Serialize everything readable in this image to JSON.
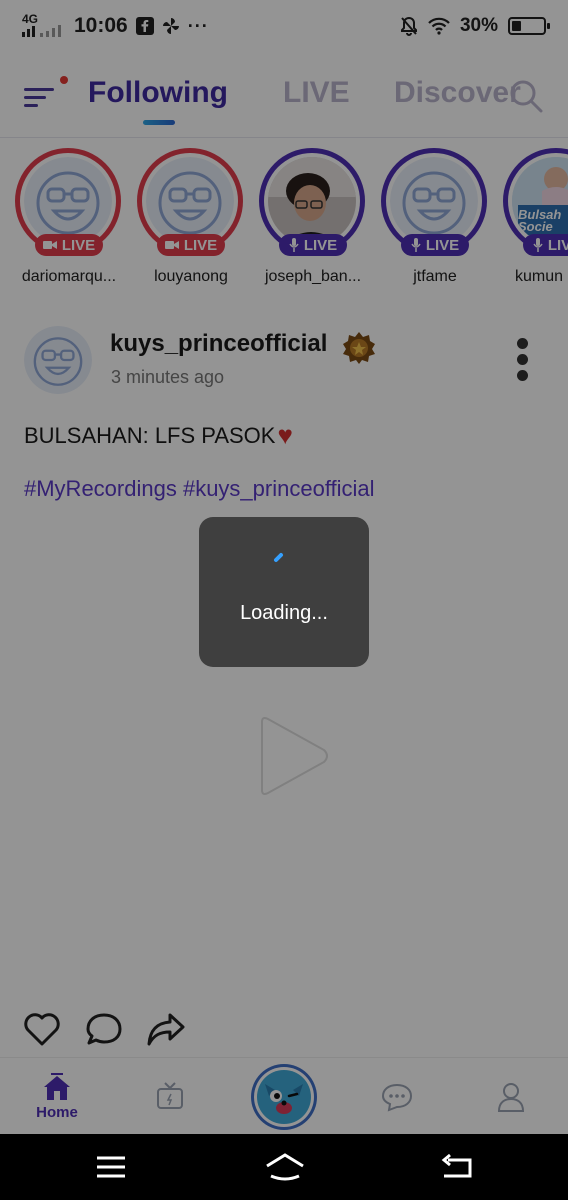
{
  "status_bar": {
    "network": "4G",
    "time": "10:06",
    "battery": "30%",
    "battery_level": 0.3,
    "icons": [
      "signal-icon",
      "facebook-icon",
      "pinwheel-icon",
      "more-dots-icon",
      "bell-off-icon",
      "wifi-icon",
      "battery-icon"
    ]
  },
  "header": {
    "tabs": [
      {
        "label": "Following",
        "active": true
      },
      {
        "label": "LIVE",
        "active": false
      },
      {
        "label": "Discover",
        "active": false
      }
    ],
    "icons": [
      "menu-icon",
      "search-icon"
    ]
  },
  "stories": [
    {
      "name": "dariomarqu...",
      "badge": "LIVE",
      "type": "video",
      "avatar": "default-avatar"
    },
    {
      "name": "louyanong",
      "badge": "LIVE",
      "type": "video",
      "avatar": "default-avatar"
    },
    {
      "name": "joseph_ban...",
      "badge": "LIVE",
      "type": "audio",
      "avatar": "photo"
    },
    {
      "name": "jtfame",
      "badge": "LIVE",
      "type": "audio",
      "avatar": "default-avatar"
    },
    {
      "name": "kumun",
      "badge": "LIVE",
      "type": "audio",
      "avatar": "poster",
      "poster_text": "Bulsah Socie"
    }
  ],
  "post": {
    "username": "kuys_princeofficial",
    "time": "3 minutes ago",
    "caption": "BULSAHAN: LFS PASOK",
    "caption_emoji": "♥",
    "hashtags": "#MyRecordings #kuys_princeofficial"
  },
  "actions": [
    "heart-icon",
    "comment-icon",
    "share-icon"
  ],
  "bottom_nav": {
    "items": [
      {
        "label": "Home",
        "icon": "home-icon",
        "active": true
      },
      {
        "label": "",
        "icon": "tv-icon",
        "active": false
      },
      {
        "label": "",
        "icon": "mascot-icon",
        "active": false
      },
      {
        "label": "",
        "icon": "chat-icon",
        "active": false
      },
      {
        "label": "",
        "icon": "profile-icon",
        "active": false
      }
    ]
  },
  "loading": {
    "text": "Loading..."
  },
  "colors": {
    "brand": "#3f2aa1",
    "live_video": "#e23d4d",
    "live_audio": "#4f2fb5",
    "hashtag": "#5b39c6"
  }
}
